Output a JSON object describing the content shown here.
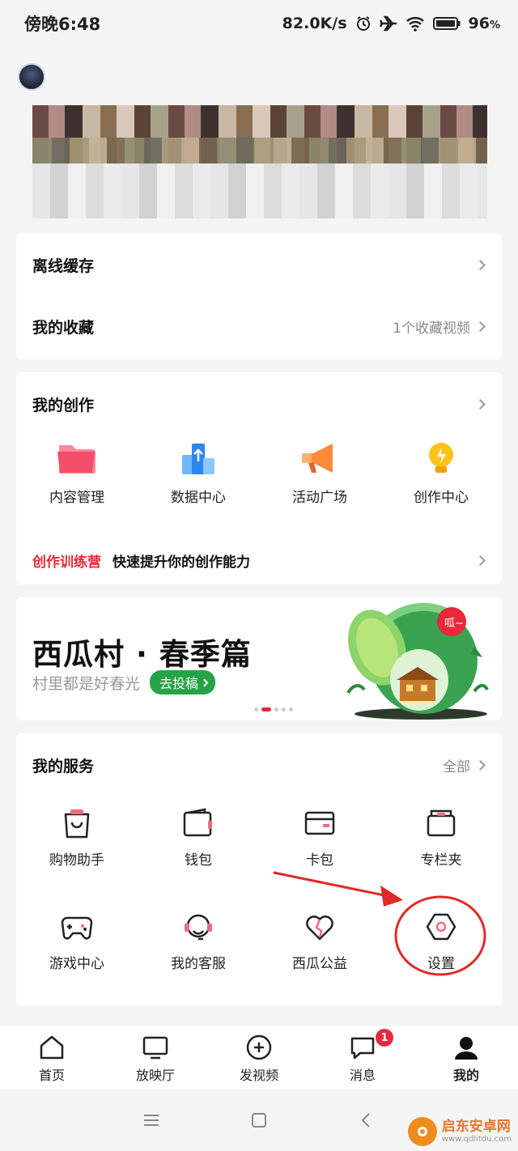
{
  "status_bar": {
    "time": "傍晚6:48",
    "network_speed": "82.0K/s",
    "battery": "96",
    "battery_unit": "%"
  },
  "list_card": {
    "offline_cache": "离线缓存",
    "favorites": "我的收藏",
    "favorites_count": "1个收藏视频"
  },
  "creation": {
    "title": "我的创作",
    "items": [
      {
        "label": "内容管理",
        "icon": "folder-icon"
      },
      {
        "label": "数据中心",
        "icon": "data-chart-icon"
      },
      {
        "label": "活动广场",
        "icon": "megaphone-icon"
      },
      {
        "label": "创作中心",
        "icon": "lightbulb-icon"
      }
    ],
    "training_label": "创作训练营",
    "training_text": "快速提升你的创作能力"
  },
  "banner": {
    "title": "西瓜村 · 春季篇",
    "subtitle": "村里都是好春光",
    "button": "去投稿",
    "badge_text": "呱~",
    "active_slide": 2,
    "slide_count": 5
  },
  "services": {
    "title": "我的服务",
    "all_label": "全部",
    "items": [
      {
        "label": "购物助手",
        "icon": "shopping-bag-icon"
      },
      {
        "label": "钱包",
        "icon": "wallet-icon"
      },
      {
        "label": "卡包",
        "icon": "card-icon"
      },
      {
        "label": "专栏夹",
        "icon": "column-folder-icon"
      },
      {
        "label": "游戏中心",
        "icon": "gamepad-icon"
      },
      {
        "label": "我的客服",
        "icon": "headset-icon"
      },
      {
        "label": "西瓜公益",
        "icon": "heart-icon"
      },
      {
        "label": "设置",
        "icon": "gear-icon"
      }
    ]
  },
  "tabbar": {
    "items": [
      {
        "label": "首页",
        "icon": "home-icon"
      },
      {
        "label": "放映厅",
        "icon": "monitor-icon"
      },
      {
        "label": "发视频",
        "icon": "add-video-icon"
      },
      {
        "label": "消息",
        "icon": "message-icon",
        "badge": "1"
      },
      {
        "label": "我的",
        "icon": "profile-icon",
        "active": true
      }
    ]
  },
  "watermark": {
    "name": "启东安卓网",
    "url": "www.qdlitdu.com"
  },
  "colors": {
    "accent_red": "#e8283b",
    "banner_green": "#27a347",
    "annotation_red": "#e02a2a"
  }
}
